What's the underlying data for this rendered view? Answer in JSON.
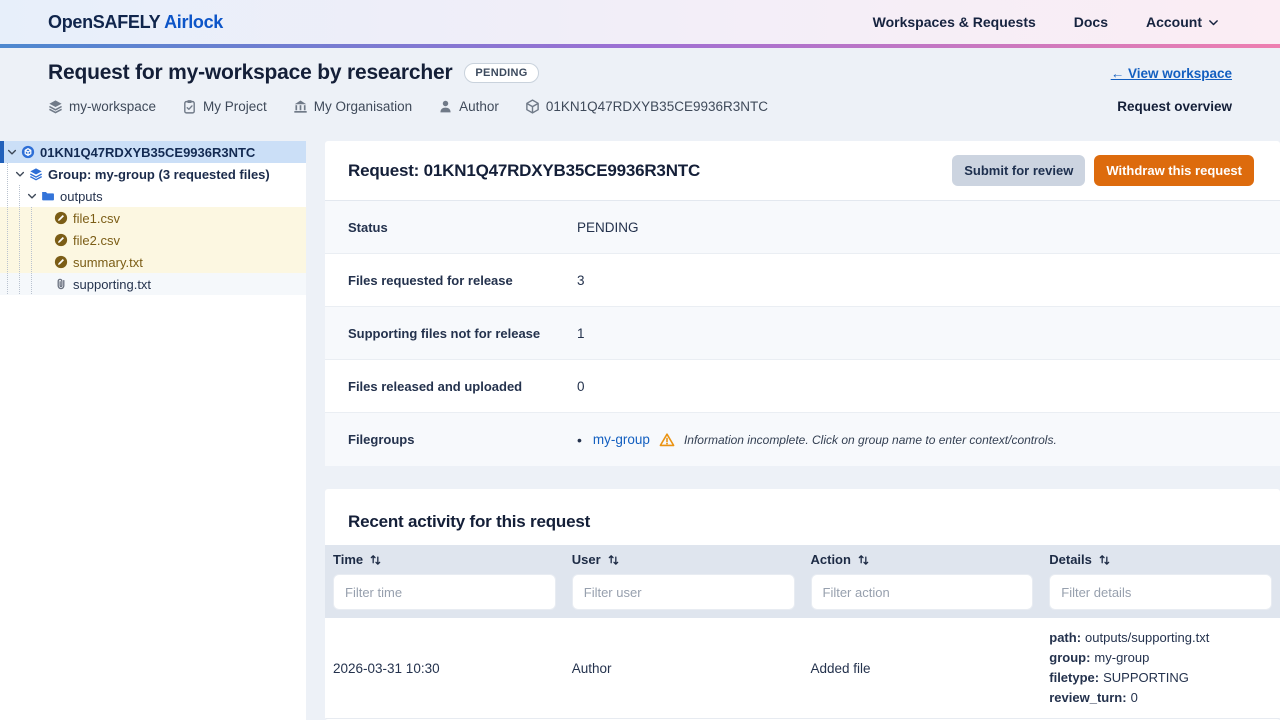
{
  "brand": {
    "primary": "OpenSAFELY",
    "secondary": "Airlock"
  },
  "nav": {
    "workspaces_label": "Workspaces & Requests",
    "docs_label": "Docs",
    "account_label": "Account"
  },
  "page_header": {
    "title": "Request for my-workspace by researcher",
    "status_badge": "PENDING",
    "view_workspace_link": "← View workspace",
    "overview_label": "Request overview",
    "meta": [
      {
        "icon": "layers-icon",
        "label": "my-workspace"
      },
      {
        "icon": "clipboard-icon",
        "label": "My Project"
      },
      {
        "icon": "organisation-icon",
        "label": "My Organisation"
      },
      {
        "icon": "person-icon",
        "label": "Author"
      },
      {
        "icon": "package-icon",
        "label": "01KN1Q47RDXYB35CE9936R3NTC"
      }
    ]
  },
  "tree": {
    "items": [
      {
        "icon": "request-icon",
        "label": "01KN1Q47RDXYB35CE9936R3NTC",
        "state": "selected"
      },
      {
        "icon": "group-layers-icon",
        "label": "Group: my-group (3 requested files)",
        "state": "expanded"
      },
      {
        "icon": "folder-icon",
        "label": "outputs",
        "state": "expanded"
      },
      {
        "icon": "output-file-icon",
        "label": "file1.csv",
        "state": "requested"
      },
      {
        "icon": "output-file-icon",
        "label": "file2.csv",
        "state": "requested"
      },
      {
        "icon": "output-file-icon",
        "label": "summary.txt",
        "state": "requested"
      },
      {
        "icon": "paperclip-icon",
        "label": "supporting.txt",
        "state": "supporting"
      }
    ]
  },
  "request_panel": {
    "heading": "Request: 01KN1Q47RDXYB35CE9936R3NTC",
    "submit_button": "Submit for review",
    "withdraw_button": "Withdraw this request",
    "summary_rows": [
      {
        "label": "Status",
        "value": "PENDING"
      },
      {
        "label": "Files requested for release",
        "value": "3"
      },
      {
        "label": "Supporting files not for release",
        "value": "1"
      },
      {
        "label": "Files released and uploaded",
        "value": "0"
      }
    ],
    "filegroups_row": {
      "label": "Filegroups",
      "group_link": "my-group",
      "warning_text": "Information incomplete. Click on group name to enter context/controls."
    }
  },
  "activity": {
    "heading": "Recent activity for this request",
    "columns": [
      {
        "label": "Time",
        "placeholder": "Filter time"
      },
      {
        "label": "User",
        "placeholder": "Filter user"
      },
      {
        "label": "Action",
        "placeholder": "Filter action"
      },
      {
        "label": "Details",
        "placeholder": "Filter details"
      }
    ],
    "rows": [
      {
        "time": "2026-03-31 10:30",
        "user": "Author",
        "action": "Added file",
        "details": [
          {
            "key": "path:",
            "value": "outputs/supporting.txt"
          },
          {
            "key": "group:",
            "value": "my-group"
          },
          {
            "key": "filetype:",
            "value": "SUPPORTING"
          },
          {
            "key": "review_turn:",
            "value": "0"
          }
        ]
      }
    ]
  },
  "colors": {
    "accent_blue": "#0d55c8",
    "link_blue": "#135fc0",
    "warning_orange": "#dd6b0d",
    "warning_icon": "#ea9312",
    "selected_row_bg": "#cbdff7",
    "requested_row_bg": "#fcf7e1",
    "gradient": [
      "#4d88cf",
      "#9e6fd3",
      "#ee7fb0"
    ]
  }
}
